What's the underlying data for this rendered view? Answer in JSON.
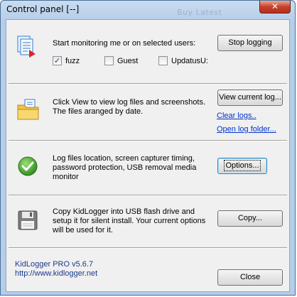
{
  "window": {
    "title": "Control panel  [--]",
    "ghost_title": "Buy Latest",
    "close_glyph": "✕"
  },
  "section_monitor": {
    "description": "Start monitoring me or on selected users:",
    "button": "Stop logging",
    "users": [
      {
        "label": "fuzz",
        "checked": true
      },
      {
        "label": "Guest",
        "checked": false
      },
      {
        "label": "UpdatusU:",
        "checked": false
      }
    ]
  },
  "section_view": {
    "description_line1": "Click View to view log files and screenshots.",
    "description_line2": "The files aranged by date.",
    "button": "View current log...",
    "link_clear": "Clear logs..",
    "link_open": "Open log folder..."
  },
  "section_options": {
    "description_line1": "Log files location, screen capturer timing,",
    "description_line2": "password protection, USB removal media",
    "description_line3": "monitor",
    "button": "Options..."
  },
  "section_copy": {
    "description_line1": "Copy KidLogger into USB flash drive and",
    "description_line2": "setup it for silent install. Your current options",
    "description_line3": "will be used for it.",
    "button": "Copy..."
  },
  "footer": {
    "product": "KidLogger PRO v5.6.7",
    "url": "http://www.kidlogger.net",
    "close_button": "Close"
  },
  "icons": {
    "monitor": "document-pages-icon",
    "view": "folder-icon",
    "options": "green-check-icon",
    "copy": "floppy-disk-icon"
  }
}
